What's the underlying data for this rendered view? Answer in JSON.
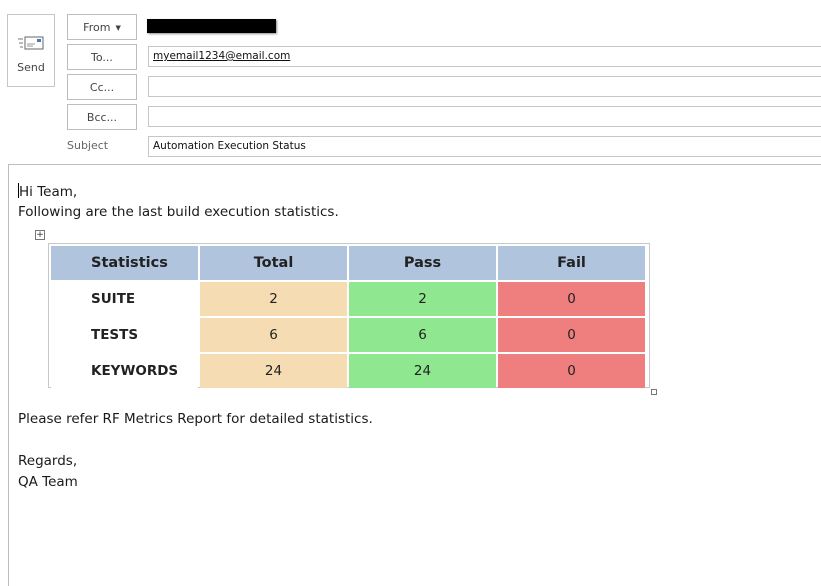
{
  "send": {
    "label": "Send"
  },
  "header": {
    "from_label": "From",
    "to_label": "To...",
    "cc_label": "Cc...",
    "bcc_label": "Bcc...",
    "subject_label": "Subject",
    "to_value": "myemail1234@email.com",
    "cc_value": "",
    "bcc_value": "",
    "subject_value": "Automation Execution Status"
  },
  "body": {
    "greeting": "Hi Team,",
    "intro": "Following are the last build execution statistics.",
    "refer": "Please refer RF Metrics Report for detailed statistics.",
    "regards": "Regards,",
    "signature": "QA Team"
  },
  "table": {
    "headers": [
      "Statistics",
      "Total",
      "Pass",
      "Fail"
    ],
    "rows": [
      {
        "label": "SUITE",
        "total": "2",
        "pass": "2",
        "fail": "0"
      },
      {
        "label": "TESTS",
        "total": "6",
        "pass": "6",
        "fail": "0"
      },
      {
        "label": "KEYWORDS",
        "total": "24",
        "pass": "24",
        "fail": "0"
      }
    ],
    "colors": {
      "header": "#b0c4dd",
      "total": "#f6dcb3",
      "pass": "#8fe88f",
      "fail": "#ef7f7f"
    }
  }
}
